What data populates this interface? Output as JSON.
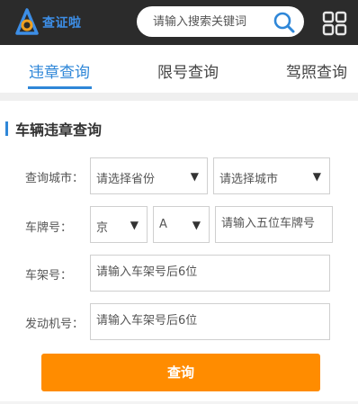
{
  "header": {
    "logo_text": "查证啦",
    "search_placeholder": "请输入搜索关键词"
  },
  "tabs": [
    {
      "label": "违章查询",
      "active": true
    },
    {
      "label": "限号查询",
      "active": false
    },
    {
      "label": "驾照查询",
      "active": false
    }
  ],
  "section": {
    "title": "车辆违章查询"
  },
  "form": {
    "city_label": "查询城市：",
    "province_select": "请选择省份",
    "city_select": "请选择城市",
    "plate_label": "车牌号：",
    "plate_prefix": "京",
    "plate_letter": "A",
    "plate_placeholder": "请输入五位车牌号",
    "frame_label": "车架号：",
    "frame_placeholder": "请输入车架号后6位",
    "engine_label": "发动机号：",
    "engine_placeholder": "请输入车架号后6位",
    "submit_label": "查询"
  },
  "colors": {
    "topbar": "#2b2b2b",
    "accent": "#2f87d8",
    "button": "#ff8c00"
  }
}
